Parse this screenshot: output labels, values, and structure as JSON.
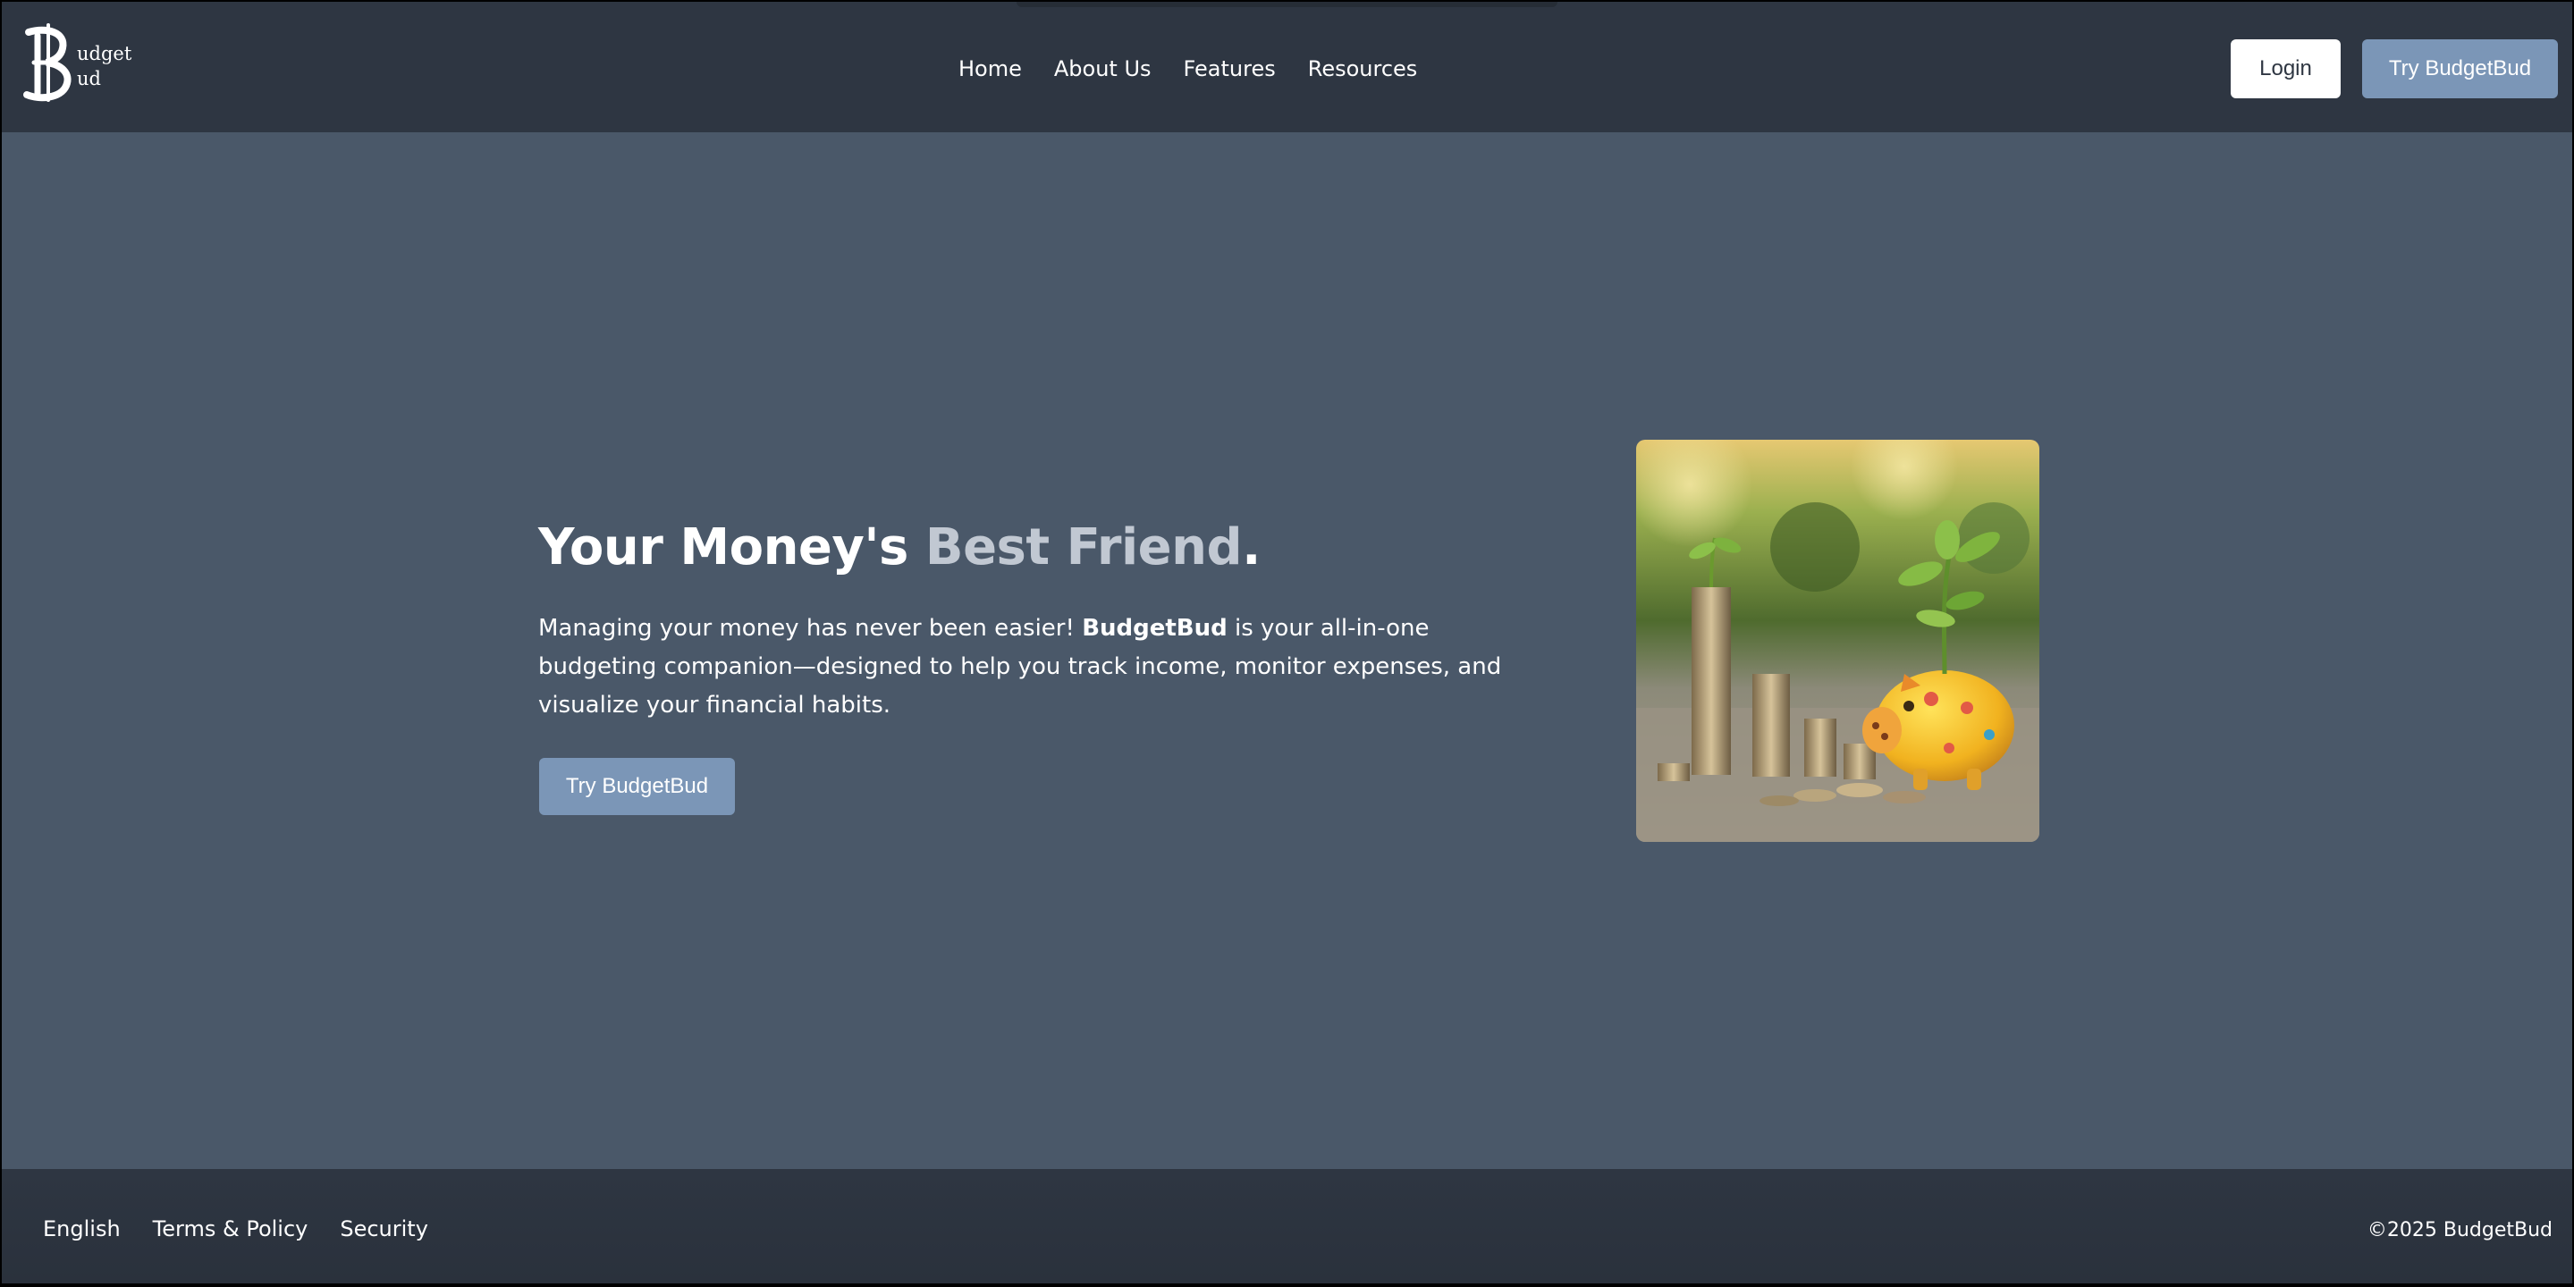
{
  "brand": {
    "logo_line1": "udget",
    "logo_line2": "ud",
    "logo_icon": "dollar-b-icon"
  },
  "nav": {
    "links": [
      "Home",
      "About Us",
      "Features",
      "Resources"
    ],
    "login_label": "Login",
    "try_label": "Try BudgetBud"
  },
  "hero": {
    "title_part1": "Your Money's ",
    "title_accent": "Best Friend",
    "title_end": ".",
    "desc_part1": "Managing your money has never been easier! ",
    "desc_bold": "BudgetBud",
    "desc_part2": " is your all-in-one budgeting companion—designed to help you track income, monitor expenses, and visualize your financial habits.",
    "cta_label": "Try BudgetBud",
    "image_subject": "coin stacks with seedlings and yellow piggy bank"
  },
  "footer": {
    "links": [
      "English",
      "Terms & Policy",
      "Security"
    ],
    "copyright": "©2025 BudgetBud"
  },
  "colors": {
    "nav_bg": "#2e3642",
    "page_bg": "#4a5869",
    "accent_button": "#7b96b7",
    "title_accent": "#c1c8d2"
  }
}
